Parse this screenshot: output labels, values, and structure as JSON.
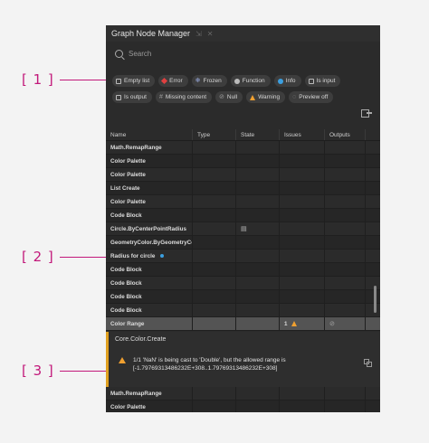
{
  "callouts": [
    "[ 1 ]",
    "[ 2 ]",
    "[ 3 ]"
  ],
  "panel": {
    "title": "Graph Node Manager",
    "search_placeholder": "Search"
  },
  "filters_row1": [
    {
      "label": "Empty list",
      "icon": "empty-list-icon"
    },
    {
      "label": "Error",
      "icon": "error-icon"
    },
    {
      "label": "Frozen",
      "icon": "frozen-icon"
    },
    {
      "label": "Function",
      "icon": "function-icon"
    },
    {
      "label": "Info",
      "icon": "info-icon"
    },
    {
      "label": "Is input",
      "icon": "is-input-icon"
    }
  ],
  "filters_row2": [
    {
      "label": "Is output",
      "icon": "is-output-icon"
    },
    {
      "label": "Missing content",
      "icon": "missing-content-icon"
    },
    {
      "label": "Null",
      "icon": "null-icon"
    },
    {
      "label": "Warning",
      "icon": "warning-icon"
    },
    {
      "label": "Preview off",
      "icon": "preview-off-icon"
    }
  ],
  "columns": [
    "Name",
    "Type",
    "State",
    "Issues",
    "Outputs"
  ],
  "rows": [
    {
      "name": "Math.RemapRange"
    },
    {
      "name": "Color Palette"
    },
    {
      "name": "Color Palette"
    },
    {
      "name": "List Create"
    },
    {
      "name": "Color Palette"
    },
    {
      "name": "Code Block"
    },
    {
      "name": "Circle.ByCenterPointRadius"
    },
    {
      "name": "GeometryColor.ByGeometryCol"
    },
    {
      "name": "Radius for circle"
    },
    {
      "name": "Code Block"
    },
    {
      "name": "Code Block"
    },
    {
      "name": "Code Block"
    },
    {
      "name": "Code Block"
    },
    {
      "name": "Color Range",
      "issues": "1"
    }
  ],
  "detail": {
    "node_type": "Core.Color.Create",
    "message_line1": "1/1 'NaN' is being cast to 'Double', but the allowed range is",
    "message_line2": "[-1.79769313486232E+308..1.79769313486232E+308]"
  },
  "rows_after": [
    {
      "name": "Math.RemapRange"
    },
    {
      "name": "Color Palette"
    }
  ],
  "colors": {
    "accent": "#c2187a",
    "warning": "#f0a030",
    "info": "#3b9fe0",
    "error": "#e04040"
  }
}
